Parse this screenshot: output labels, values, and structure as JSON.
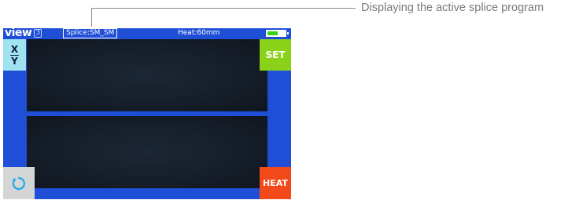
{
  "annotation": {
    "text": "Displaying the active splice program"
  },
  "status_bar": {
    "logo": "view",
    "logo_number": "3",
    "splice_program": "Splice:SM_SM",
    "heat_program": "Heat:60mm",
    "battery_level": 0.6,
    "battery_color": "#32d416"
  },
  "buttons": {
    "xy_top": "X",
    "xy_bottom": "Y",
    "set": "SET",
    "heat": "HEAT",
    "reset_icon": "refresh-icon"
  },
  "colors": {
    "frame_blue": "#1f4fd6",
    "set_green": "#8ad21a",
    "heat_orange": "#f24a1a",
    "xy_cyan": "#9fe3f0",
    "reset_gray": "#d4d6d6"
  }
}
